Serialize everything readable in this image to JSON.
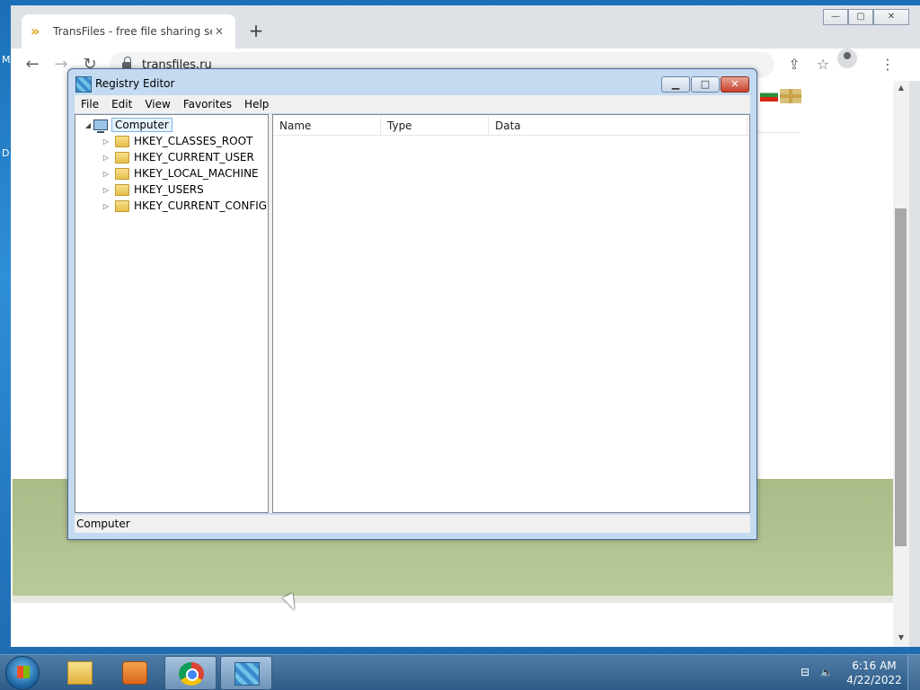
{
  "desktop": {
    "left_text_1": "M",
    "left_text_2": "D"
  },
  "browser": {
    "tab_title": "TransFiles - free file sharing servi",
    "tab_close": "✕",
    "new_tab": "+",
    "window_controls": {
      "minimize": "—",
      "restore": "▢",
      "close": "✕"
    },
    "nav": {
      "back": "←",
      "forward": "→",
      "reload": "↻"
    },
    "url": "transfiles.ru",
    "toolbar_icons": {
      "share": "⇪",
      "bookmark": "☆",
      "menu": "⋮"
    },
    "scroll_up": "▲",
    "scroll_down": "▼"
  },
  "regedit": {
    "title": "Registry Editor",
    "controls": {
      "minimize": "▁",
      "maximize": "□",
      "close": "✕"
    },
    "menu": [
      "File",
      "Edit",
      "View",
      "Favorites",
      "Help"
    ],
    "tree": {
      "root_expander": "◢",
      "root": "Computer",
      "item_expander": "▷",
      "items": [
        "HKEY_CLASSES_ROOT",
        "HKEY_CURRENT_USER",
        "HKEY_LOCAL_MACHINE",
        "HKEY_USERS",
        "HKEY_CURRENT_CONFIG"
      ]
    },
    "columns": [
      "Name",
      "Type",
      "Data"
    ],
    "status": "Computer"
  },
  "taskbar": {
    "tray_icons": {
      "network": "⊟",
      "volume": "🔈"
    },
    "time": "6:16 AM",
    "date": "4/22/2022"
  }
}
